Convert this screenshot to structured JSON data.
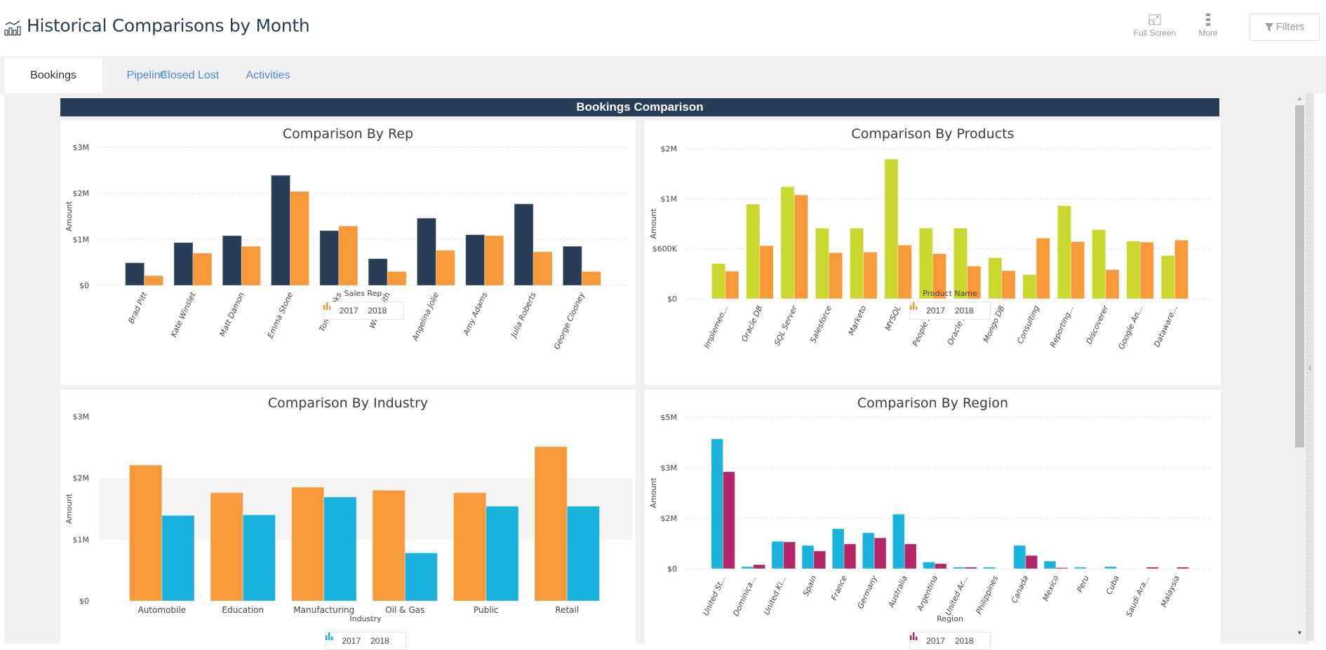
{
  "header": {
    "title": "Historical Comparisons by Month",
    "icon": "bar-line-chart-icon",
    "tools": [
      {
        "label": "Full Screen",
        "icon": "expand-icon"
      },
      {
        "label": "More",
        "icon": "vertical-dots-icon"
      }
    ],
    "filters_label": "Filters",
    "filters_icon": "funnel-icon"
  },
  "tabs": [
    {
      "label": "Bookings",
      "active": true
    },
    {
      "label": "Pipeline",
      "active": false
    },
    {
      "label": "Closed Lost",
      "active": false
    },
    {
      "label": "Activities",
      "active": false
    }
  ],
  "section": {
    "title": "Bookings Comparison"
  },
  "colors": {
    "navy": "#283d55",
    "orange": "#f79839",
    "lime": "#c9d72f",
    "cyan": "#19b2dc",
    "magenta": "#b52466",
    "tab_link": "#4a8bd6"
  },
  "chart_data": [
    {
      "id": "rep",
      "type": "bar",
      "title": "Comparison By Rep",
      "xlabel": "Sales Rep",
      "ylabel": "Amount",
      "ylim": [
        0,
        3000000
      ],
      "yticks": [
        {
          "value": 0,
          "label": "$0"
        },
        {
          "value": 1000000,
          "label": "$1M"
        },
        {
          "value": 2000000,
          "label": "$2M"
        },
        {
          "value": 3000000,
          "label": "$3M"
        }
      ],
      "grid": true,
      "legend": "bottom-center",
      "rotate_labels": true,
      "categories": [
        "Brad Pitt",
        "Kate Winslet",
        "Matt Damon",
        "Emma Stone",
        "Tom Hanks",
        "Will Smith",
        "Angelina Jolie",
        "Amy Adams",
        "Julia Roberts",
        "George Clooney"
      ],
      "series": [
        {
          "name": "2017",
          "color": "#283d55",
          "values": [
            490000,
            930000,
            1080000,
            2390000,
            1190000,
            580000,
            1460000,
            1100000,
            1770000,
            850000
          ]
        },
        {
          "name": "2018",
          "color": "#f79839",
          "values": [
            210000,
            700000,
            850000,
            2040000,
            1290000,
            300000,
            760000,
            1080000,
            730000,
            300000
          ]
        }
      ]
    },
    {
      "id": "products",
      "type": "bar",
      "title": "Comparison By Products",
      "xlabel": "Product Name",
      "ylabel": "Amount",
      "ylim": [
        0,
        2000000
      ],
      "yticks": [
        {
          "value": 0,
          "label": "$0"
        },
        {
          "value": 600000,
          "label": "$600K"
        },
        {
          "value": 1000000,
          "label": "$1M"
        },
        {
          "value": 2000000,
          "label": "$2M"
        }
      ],
      "grid": true,
      "legend": "bottom-center",
      "rotate_labels": true,
      "categories": [
        "Implemen...",
        "Oracle DB",
        "SQL Server",
        "Salesforce",
        "Marketo",
        "MYSQL",
        "People Soft",
        "Oracle ERP",
        "Mongo DB",
        "Consulting",
        "Reporting...",
        "Discoverer",
        "Google An...",
        "Dataware..."
      ],
      "series": [
        {
          "name": "2017",
          "color": "#c9d72f",
          "values": [
            420000,
            956000,
            1240000,
            764000,
            764000,
            1790000,
            764000,
            764000,
            492000,
            288000,
            944000,
            752000,
            660000,
            516000
          ]
        },
        {
          "name": "2018",
          "color": "#f79839",
          "values": [
            330000,
            624000,
            1075000,
            552000,
            558000,
            628000,
            540000,
            390000,
            336000,
            684000,
            656000,
            348000,
            652000,
            668000
          ]
        }
      ]
    },
    {
      "id": "industry",
      "type": "bar",
      "title": "Comparison By Industry",
      "xlabel": "Industry",
      "ylabel": "Amount",
      "ylim": [
        0,
        3000000
      ],
      "yticks": [
        {
          "value": 0,
          "label": "$0"
        },
        {
          "value": 1000000,
          "label": "$1M"
        },
        {
          "value": 2000000,
          "label": "$2M"
        },
        {
          "value": 3000000,
          "label": "$3M"
        }
      ],
      "grid": false,
      "band": [
        1000000,
        2000000
      ],
      "legend": "bottom-center",
      "rotate_labels": false,
      "categories": [
        "Automobile",
        "Education",
        "Manufacturing",
        "Oil & Gas",
        "Public",
        "Retail"
      ],
      "series": [
        {
          "name": "2017",
          "color": "#f79839",
          "values": [
            2210000,
            1760000,
            1850000,
            1800000,
            1760000,
            2510000
          ]
        },
        {
          "name": "2018",
          "color": "#19b2dc",
          "values": [
            1390000,
            1400000,
            1690000,
            780000,
            1540000,
            1540000
          ]
        }
      ]
    },
    {
      "id": "region",
      "type": "bar",
      "title": "Comparison By Region",
      "xlabel": "Region",
      "ylabel": "Amount",
      "ylim": [
        0,
        5000000
      ],
      "yticks": [
        {
          "value": 0,
          "label": "$0"
        },
        {
          "value": 2000000,
          "label": "$2M"
        },
        {
          "value": 3000000,
          "label": "$3M"
        },
        {
          "value": 5000000,
          "label": "$5M"
        }
      ],
      "grid": true,
      "legend": "bottom-center",
      "rotate_labels": true,
      "categories": [
        "United St...",
        "Dominica...",
        "United Ki...",
        "Spain",
        "France",
        "Germany",
        "Australia",
        "Argentina",
        "United Ar...",
        "Philippines",
        "Canada",
        "Mexico",
        "Peru",
        "Cuba",
        "Saudi Ara...",
        "Malaysia"
      ],
      "series": [
        {
          "name": "2017",
          "color": "#19b2dc",
          "values": [
            4140000,
            80000,
            1080000,
            920000,
            1580000,
            1420000,
            2080000,
            260000,
            60000,
            60000,
            920000,
            300000,
            60000,
            80000,
            0,
            0
          ]
        },
        {
          "name": "2018",
          "color": "#b52466",
          "values": [
            2920000,
            160000,
            1060000,
            700000,
            980000,
            1220000,
            980000,
            200000,
            60000,
            0,
            520000,
            40000,
            0,
            0,
            60000,
            60000
          ]
        }
      ]
    }
  ]
}
